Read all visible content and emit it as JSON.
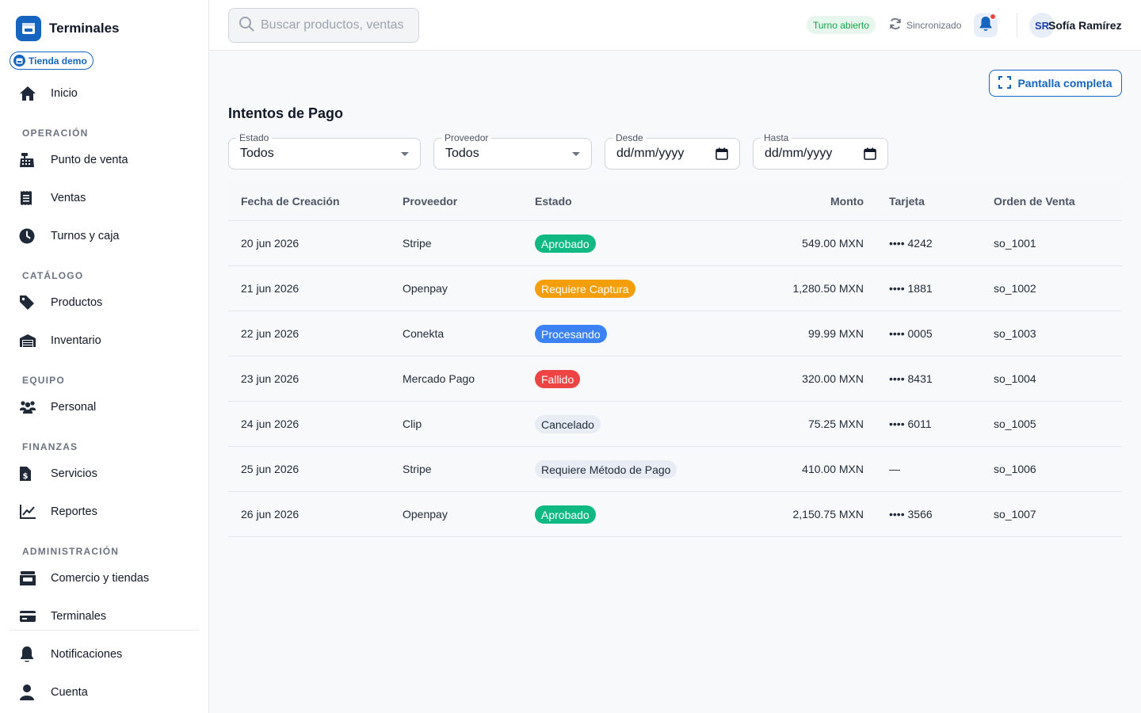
{
  "sidebar": {
    "app_name": "Terminales",
    "store_chip": "Tienda demo",
    "items": [
      {
        "label": "Inicio",
        "icon": "home-icon"
      },
      {
        "label": "Punto de venta",
        "icon": "cash-register-icon"
      },
      {
        "label": "Ventas",
        "icon": "receipt-icon"
      },
      {
        "label": "Turnos y caja",
        "icon": "clock-icon"
      },
      {
        "label": "Productos",
        "icon": "tag-icon"
      },
      {
        "label": "Inventario",
        "icon": "warehouse-icon"
      },
      {
        "label": "Personal",
        "icon": "users-icon"
      },
      {
        "label": "Servicios",
        "icon": "dollar-file-icon"
      },
      {
        "label": "Reportes",
        "icon": "chart-line-icon"
      },
      {
        "label": "Comercio y tiendas",
        "icon": "store-icon"
      },
      {
        "label": "Terminales",
        "icon": "credit-card-icon"
      },
      {
        "label": "Notificaciones",
        "icon": "bell-icon"
      },
      {
        "label": "Cuenta",
        "icon": "user-icon"
      }
    ],
    "sections": [
      "OPERACIÓN",
      "CATÁLOGO",
      "EQUIPO",
      "FINANZAS",
      "ADMINISTRACIÓN"
    ]
  },
  "topbar": {
    "search_placeholder": "Buscar productos, ventas",
    "shift_status": "Turno abierto",
    "sync_status": "Sincronizado",
    "user_initials": "SR",
    "user_name": "Sofía Ramírez"
  },
  "main": {
    "fullscreen_label": "Pantalla completa",
    "title": "Intentos de Pago",
    "filters": {
      "estado_label": "Estado",
      "estado_value": "Todos",
      "proveedor_label": "Proveedor",
      "proveedor_value": "Todos",
      "desde_label": "Desde",
      "desde_value": "dd/mm/yyyy",
      "hasta_label": "Hasta",
      "hasta_value": "dd/mm/yyyy"
    },
    "columns": [
      "Fecha de Creación",
      "Proveedor",
      "Estado",
      "Monto",
      "Tarjeta",
      "Orden de Venta"
    ],
    "rows": [
      {
        "fecha": "20 jun 2026",
        "proveedor": "Stripe",
        "estado": "Aprobado",
        "monto": "549.00 MXN",
        "tarjeta": "•••• 4242",
        "orden": "so_1001"
      },
      {
        "fecha": "21 jun 2026",
        "proveedor": "Openpay",
        "estado": "Requiere Captura",
        "monto": "1,280.50 MXN",
        "tarjeta": "•••• 1881",
        "orden": "so_1002"
      },
      {
        "fecha": "22 jun 2026",
        "proveedor": "Conekta",
        "estado": "Procesando",
        "monto": "99.99 MXN",
        "tarjeta": "•••• 0005",
        "orden": "so_1003"
      },
      {
        "fecha": "23 jun 2026",
        "proveedor": "Mercado Pago",
        "estado": "Fallido",
        "monto": "320.00 MXN",
        "tarjeta": "•••• 8431",
        "orden": "so_1004"
      },
      {
        "fecha": "24 jun 2026",
        "proveedor": "Clip",
        "estado": "Cancelado",
        "monto": "75.25 MXN",
        "tarjeta": "•••• 6011",
        "orden": "so_1005"
      },
      {
        "fecha": "25 jun 2026",
        "proveedor": "Stripe",
        "estado": "Requiere Método de Pago",
        "monto": "410.00 MXN",
        "tarjeta": "—",
        "orden": "so_1006"
      },
      {
        "fecha": "26 jun 2026",
        "proveedor": "Openpay",
        "estado": "Aprobado",
        "monto": "2,150.75 MXN",
        "tarjeta": "•••• 3566",
        "orden": "so_1007"
      }
    ]
  },
  "colors": {
    "brand": "#1565c0",
    "status_aprobado": "#10b981",
    "status_requiere_captura": "#f59e0b",
    "status_procesando": "#3b82f6",
    "status_fallido": "#ef4444",
    "status_neutral_bg": "#e8edf5"
  }
}
